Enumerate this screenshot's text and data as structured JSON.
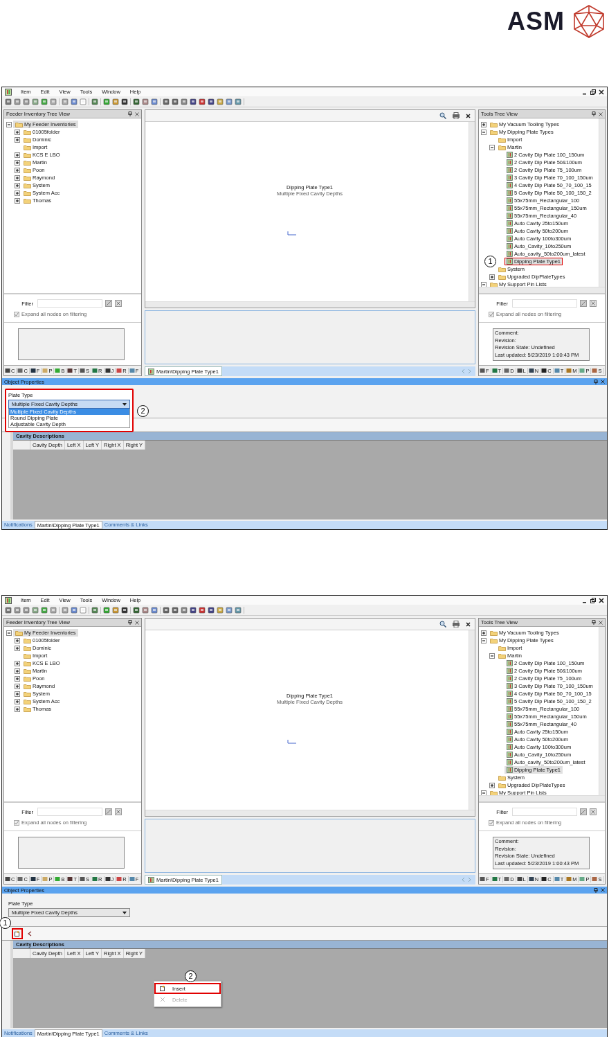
{
  "logo": {
    "text": "ASM"
  },
  "screens": [
    {
      "menu": [
        "Item",
        "Edit",
        "View",
        "Tools",
        "Window",
        "Help"
      ],
      "left_panel": {
        "title": "Feeder Inventory Tree View",
        "tree": [
          {
            "label": "My Feeder Inventories",
            "kind": "folder",
            "expanded": true,
            "selected": true,
            "children": [
              {
                "label": "01005folder",
                "kind": "folder",
                "expanded": false,
                "selected": false
              },
              {
                "label": "Dominic",
                "kind": "folder",
                "expanded": false,
                "selected": false
              },
              {
                "label": "Import",
                "kind": "folder",
                "selected": false
              },
              {
                "label": "KCS E LBO",
                "kind": "folder",
                "expanded": false,
                "selected": false
              },
              {
                "label": "Martin",
                "kind": "folder",
                "expanded": false,
                "selected": false
              },
              {
                "label": "Poon",
                "kind": "folder",
                "expanded": false,
                "selected": false
              },
              {
                "label": "Raymond",
                "kind": "folder",
                "expanded": false,
                "selected": false
              },
              {
                "label": "System",
                "kind": "folder",
                "expanded": false,
                "selected": false
              },
              {
                "label": "System Acc",
                "kind": "folder",
                "expanded": false,
                "selected": false
              },
              {
                "label": "Thomas",
                "kind": "folder",
                "expanded": false,
                "selected": false
              }
            ]
          }
        ],
        "filter": {
          "label": "Filter",
          "expand_checkbox": {
            "label": "Expand all nodes on filtering",
            "checked": true
          }
        },
        "dock_tabs": [
          "C",
          "C",
          "F",
          "P",
          "B",
          "T",
          "S",
          "R",
          "J",
          "R",
          "F"
        ]
      },
      "document": {
        "canvas_title": "Dipping Plate Type1",
        "canvas_subtitle": "Multiple Fixed Cavity Depths",
        "tab": "Martin\\Dipping Plate Type1"
      },
      "right_panel": {
        "title": "Tools Tree View",
        "tree": [
          {
            "label": "My Vacuum Tooling Types",
            "kind": "folder",
            "expanded": false,
            "selected": false
          },
          {
            "label": "My Dipping Plate Types",
            "kind": "folder",
            "expanded": true,
            "selected": false,
            "children": [
              {
                "label": "Import",
                "kind": "folder",
                "selected": false
              },
              {
                "label": "Martin",
                "kind": "folder",
                "expanded": true,
                "selected": false,
                "children": [
                  {
                    "label": "2 Cavity Dip Plate 100_150um",
                    "kind": "plate",
                    "selected": false
                  },
                  {
                    "label": "2 Cavity Dip Plate 50&100um",
                    "kind": "plate",
                    "selected": false
                  },
                  {
                    "label": "2 Cavity Dip Plate 75_100um",
                    "kind": "plate",
                    "selected": false
                  },
                  {
                    "label": "3 Cavity Dip Plate 70_100_150um",
                    "kind": "plate",
                    "selected": false
                  },
                  {
                    "label": "4 Cavity Dip Plate 50_70_100_15",
                    "kind": "plate",
                    "selected": false
                  },
                  {
                    "label": "5 Cavity Dip Plate 50_100_150_2",
                    "kind": "plate",
                    "selected": false
                  },
                  {
                    "label": "55x75mm_Rectangular_100",
                    "kind": "plate",
                    "selected": false
                  },
                  {
                    "label": "55x75mm_Rectangular_150um",
                    "kind": "plate",
                    "selected": false
                  },
                  {
                    "label": "55x75mm_Rectangular_40",
                    "kind": "plate",
                    "selected": false
                  },
                  {
                    "label": "Auto Cavity 25to150um",
                    "kind": "plate",
                    "selected": false
                  },
                  {
                    "label": "Auto Cavity 50to200um",
                    "kind": "plate",
                    "selected": false
                  },
                  {
                    "label": "Auto Cavity 100to300um",
                    "kind": "plate",
                    "selected": false
                  },
                  {
                    "label": "Auto_Cavity_10to250um",
                    "kind": "plate",
                    "selected": false
                  },
                  {
                    "label": "Auto_cavity_50to200um_latest",
                    "kind": "plate",
                    "selected": false
                  },
                  {
                    "label": "Dipping Plate Type1",
                    "kind": "plate",
                    "selected": true,
                    "highlighted": true,
                    "callout": "1"
                  }
                ]
              },
              {
                "label": "System",
                "kind": "folder",
                "selected": false
              },
              {
                "label": "Upgraded DipPlateTypes",
                "kind": "folder",
                "expanded": false,
                "selected": false
              }
            ]
          },
          {
            "label": "My Support Pin Lists",
            "kind": "folder",
            "expanded": true,
            "selected": false
          }
        ],
        "filter": {
          "label": "Filter",
          "expand_checkbox": {
            "label": "Expand all nodes on filtering",
            "checked": true
          }
        },
        "info": [
          "Comment:",
          "Revision:",
          "Revision State: Undefined",
          "Last updated: 5/23/2019 1:00:43 PM"
        ],
        "dock_tabs": [
          "F",
          "T",
          "D",
          "L",
          "N",
          "C",
          "T",
          "M",
          "P",
          "S"
        ]
      },
      "properties": {
        "title": "Object Properties",
        "plate_type": {
          "label": "Plate Type",
          "value": "Multiple Fixed Cavity Depths",
          "open": true,
          "highlighted": true,
          "callout": "2",
          "options": [
            {
              "label": "Multiple Fixed Cavity Depths",
              "selected": true
            },
            {
              "label": "Round Dipping Plate",
              "selected": false
            },
            {
              "label": "Adjustable Cavity Depth",
              "selected": false
            }
          ]
        },
        "grid": {
          "title": "Cavity Descriptions",
          "columns": [
            "Cavity Depth",
            "Left X",
            "Left Y",
            "Right X",
            "Right Y"
          ]
        },
        "bottom_tabs": [
          {
            "label": "Notifications",
            "selected": false
          },
          {
            "label": "Martin\\Dipping Plate Type1",
            "selected": true
          },
          {
            "label": "Comments & Links",
            "selected": false
          }
        ]
      }
    },
    {
      "menu": [
        "Item",
        "Edit",
        "View",
        "Tools",
        "Window",
        "Help"
      ],
      "left_panel": {
        "title": "Feeder Inventory Tree View",
        "tree": [
          {
            "label": "My Feeder Inventories",
            "kind": "folder",
            "expanded": true,
            "selected": true,
            "children": [
              {
                "label": "01005folder",
                "kind": "folder",
                "expanded": false,
                "selected": false
              },
              {
                "label": "Dominic",
                "kind": "folder",
                "expanded": false,
                "selected": false
              },
              {
                "label": "Import",
                "kind": "folder",
                "selected": false
              },
              {
                "label": "KCS E LBO",
                "kind": "folder",
                "expanded": false,
                "selected": false
              },
              {
                "label": "Martin",
                "kind": "folder",
                "expanded": false,
                "selected": false
              },
              {
                "label": "Poon",
                "kind": "folder",
                "expanded": false,
                "selected": false
              },
              {
                "label": "Raymond",
                "kind": "folder",
                "expanded": false,
                "selected": false
              },
              {
                "label": "System",
                "kind": "folder",
                "expanded": false,
                "selected": false
              },
              {
                "label": "System Acc",
                "kind": "folder",
                "expanded": false,
                "selected": false
              },
              {
                "label": "Thomas",
                "kind": "folder",
                "expanded": false,
                "selected": false
              }
            ]
          }
        ],
        "filter": {
          "label": "Filter",
          "expand_checkbox": {
            "label": "Expand all nodes on filtering",
            "checked": true
          }
        },
        "dock_tabs": [
          "C",
          "C",
          "F",
          "P",
          "B",
          "T",
          "S",
          "R",
          "J",
          "R",
          "F"
        ]
      },
      "document": {
        "canvas_title": "Dipping Plate Type1",
        "canvas_subtitle": "Multiple Fixed Cavity Depths",
        "tab": "Martin\\Dipping Plate Type1"
      },
      "right_panel": {
        "title": "Tools Tree View",
        "tree": [
          {
            "label": "My Vacuum Tooling Types",
            "kind": "folder",
            "expanded": false,
            "selected": false
          },
          {
            "label": "My Dipping Plate Types",
            "kind": "folder",
            "expanded": true,
            "selected": false,
            "children": [
              {
                "label": "Import",
                "kind": "folder",
                "selected": false
              },
              {
                "label": "Martin",
                "kind": "folder",
                "expanded": true,
                "selected": false,
                "children": [
                  {
                    "label": "2 Cavity Dip Plate 100_150um",
                    "kind": "plate",
                    "selected": false
                  },
                  {
                    "label": "2 Cavity Dip Plate 50&100um",
                    "kind": "plate",
                    "selected": false
                  },
                  {
                    "label": "2 Cavity Dip Plate 75_100um",
                    "kind": "plate",
                    "selected": false
                  },
                  {
                    "label": "3 Cavity Dip Plate 70_100_150um",
                    "kind": "plate",
                    "selected": false
                  },
                  {
                    "label": "4 Cavity Dip Plate 50_70_100_15",
                    "kind": "plate",
                    "selected": false
                  },
                  {
                    "label": "5 Cavity Dip Plate 50_100_150_2",
                    "kind": "plate",
                    "selected": false
                  },
                  {
                    "label": "55x75mm_Rectangular_100",
                    "kind": "plate",
                    "selected": false
                  },
                  {
                    "label": "55x75mm_Rectangular_150um",
                    "kind": "plate",
                    "selected": false
                  },
                  {
                    "label": "55x75mm_Rectangular_40",
                    "kind": "plate",
                    "selected": false
                  },
                  {
                    "label": "Auto Cavity 25to150um",
                    "kind": "plate",
                    "selected": false
                  },
                  {
                    "label": "Auto Cavity 50to200um",
                    "kind": "plate",
                    "selected": false
                  },
                  {
                    "label": "Auto Cavity 100to300um",
                    "kind": "plate",
                    "selected": false
                  },
                  {
                    "label": "Auto_Cavity_10to250um",
                    "kind": "plate",
                    "selected": false
                  },
                  {
                    "label": "Auto_cavity_50to200um_latest",
                    "kind": "plate",
                    "selected": false
                  },
                  {
                    "label": "Dipping Plate Type1",
                    "kind": "plate",
                    "selected": true
                  }
                ]
              },
              {
                "label": "System",
                "kind": "folder",
                "selected": false
              },
              {
                "label": "Upgraded DipPlateTypes",
                "kind": "folder",
                "expanded": false,
                "selected": false
              }
            ]
          },
          {
            "label": "My Support Pin Lists",
            "kind": "folder",
            "expanded": true,
            "selected": false
          }
        ],
        "filter": {
          "label": "Filter",
          "expand_checkbox": {
            "label": "Expand all nodes on filtering",
            "checked": true
          }
        },
        "info": [
          "Comment:",
          "Revision:",
          "Revision State: Undefined",
          "Last updated: 5/23/2019 1:00:43 PM"
        ],
        "dock_tabs": [
          "F",
          "T",
          "D",
          "L",
          "N",
          "C",
          "T",
          "M",
          "P",
          "S"
        ]
      },
      "properties": {
        "title": "Object Properties",
        "plate_type": {
          "label": "Plate Type",
          "value": "Multiple Fixed Cavity Depths",
          "open": false,
          "highlighted": false
        },
        "toolbar": [
          {
            "kind": "insert",
            "highlighted": true,
            "callout": "1"
          },
          {
            "kind": "delete",
            "highlighted": false
          }
        ],
        "grid": {
          "title": "Cavity Descriptions",
          "columns": [
            "Cavity Depth",
            "Left X",
            "Left Y",
            "Right X",
            "Right Y"
          ]
        },
        "context_menu": [
          {
            "label": "Insert",
            "kind": "insert",
            "disabled": false,
            "highlighted": true,
            "callout": "2"
          },
          {
            "label": "Delete",
            "kind": "delete",
            "disabled": true,
            "highlighted": false
          }
        ],
        "bottom_tabs": [
          {
            "label": "Notifications",
            "selected": false
          },
          {
            "label": "Martin\\Dipping Plate Type1",
            "selected": true
          },
          {
            "label": "Comments & Links",
            "selected": false
          }
        ]
      }
    }
  ]
}
